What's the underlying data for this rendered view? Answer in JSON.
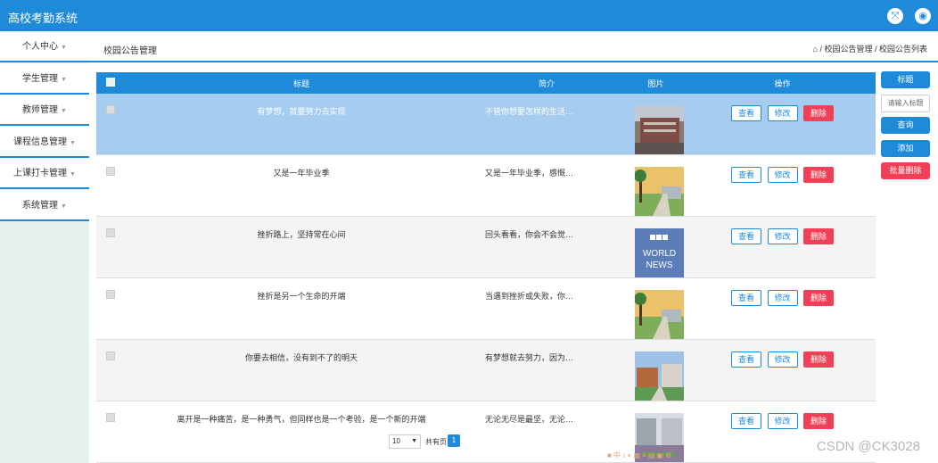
{
  "header": {
    "title": "高校考勤系统",
    "icon_left": "collapse-arrows-icon",
    "icon_right": "user-icon"
  },
  "sidebar": {
    "items": [
      {
        "label": "个人中心"
      },
      {
        "label": "学生管理"
      },
      {
        "label": "教师管理"
      },
      {
        "label": "课程信息管理"
      },
      {
        "label": "上课打卡管理"
      },
      {
        "label": "系统管理"
      }
    ]
  },
  "breadcrumb": {
    "page_title": "校园公告管理",
    "path": "⌂ / 校园公告管理 / 校园公告列表"
  },
  "table": {
    "columns": [
      "标题",
      "简介",
      "图片",
      "操作"
    ],
    "rows": [
      {
        "title": "有梦想，就要努力去实现",
        "intro": "不管你想要怎样的生活…",
        "image": "campus-building-photo"
      },
      {
        "title": "又是一年毕业季",
        "intro": "又是一年毕业季，感慨…",
        "image": "campus-palm-photo"
      },
      {
        "title": "挫折路上，坚持常在心间",
        "intro": "回头看看，你会不会觉…",
        "image": "bbc-world-news-logo"
      },
      {
        "title": "挫折是另一个生命的开端",
        "intro": "当遇到挫折或失败，你…",
        "image": "campus-palm-photo"
      },
      {
        "title": "你要去相信，没有到不了的明天",
        "intro": "有梦想就去努力，因为…",
        "image": "campus-courtyard-photo"
      },
      {
        "title": "离开是一种痛苦，是一种勇气，但同样也是一个考验，是一个新的开端",
        "intro": "无论无尽是最坚，无论…",
        "image": "campus-courtyard-photo"
      }
    ],
    "actions": {
      "view": "查看",
      "edit": "修改",
      "delete": "删除"
    }
  },
  "toolbar": {
    "title_label": "标题",
    "search_placeholder": "请输入标题",
    "query": "查询",
    "add": "添加",
    "batch_delete": "批量删除"
  },
  "pagination": {
    "page_size": "10",
    "total": "共有页",
    "current": "1"
  },
  "watermark": "CSDN @CK3028",
  "colors": {
    "primary": "#1e8ad8",
    "danger": "#ef4057",
    "selected_row": "#a6cdef"
  }
}
